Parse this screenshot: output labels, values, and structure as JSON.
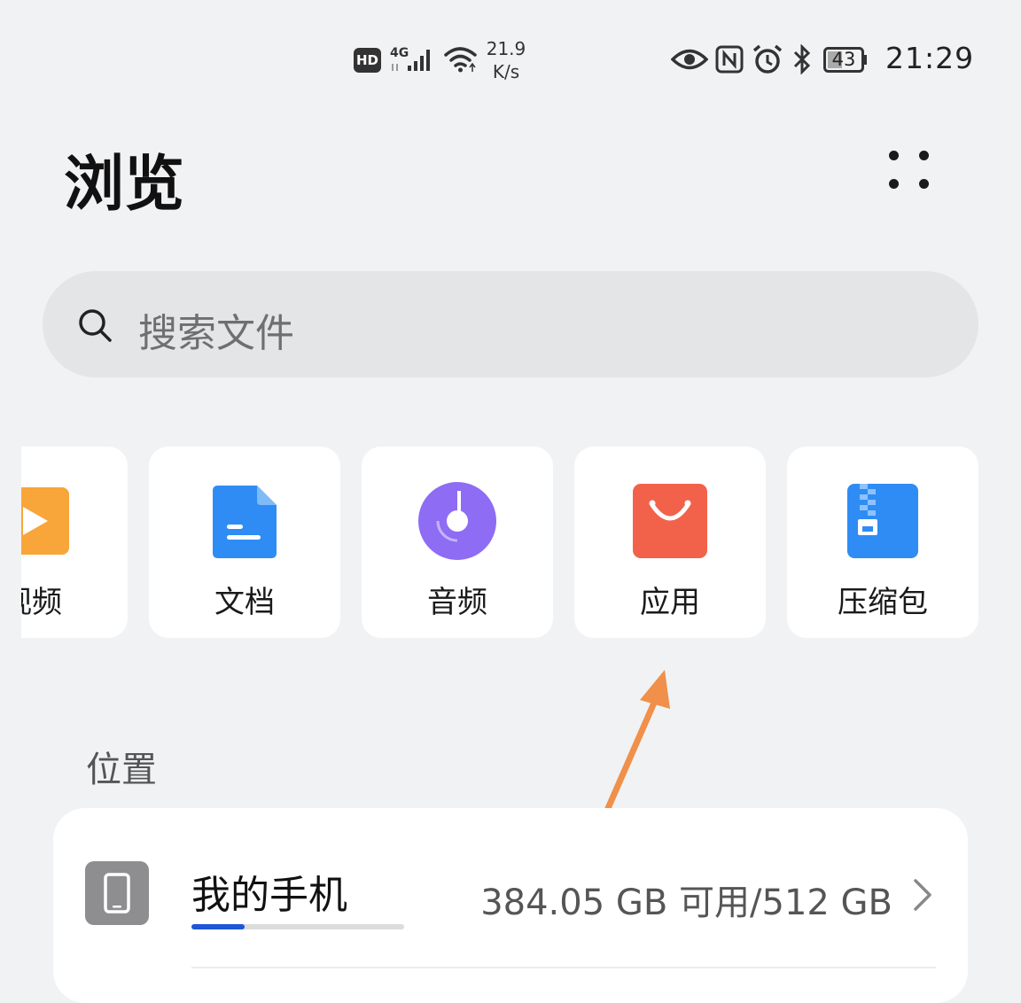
{
  "status_bar": {
    "hd_badge": "HD",
    "network_type": "4G",
    "net_speed_value": "21.9",
    "net_speed_unit": "K/s",
    "battery_level": "43",
    "time": "21:29"
  },
  "header": {
    "title": "浏览"
  },
  "search": {
    "placeholder": "搜索文件"
  },
  "categories": [
    {
      "label": "视频",
      "icon": "video-icon",
      "color": "#f8a53a"
    },
    {
      "label": "文档",
      "icon": "document-icon",
      "color": "#2f8cf4"
    },
    {
      "label": "音频",
      "icon": "music-disc-icon",
      "color": "#8e6cf4"
    },
    {
      "label": "应用",
      "icon": "shopping-bag-icon",
      "color": "#f2624a"
    },
    {
      "label": "压缩包",
      "icon": "zip-archive-icon",
      "color": "#2f8cf4"
    }
  ],
  "locations": {
    "section_title": "位置",
    "items": [
      {
        "name": "我的手机",
        "storage": "384.05 GB 可用/512 GB",
        "used_fraction": 0.25,
        "icon": "phone-icon"
      }
    ]
  },
  "colors": {
    "background": "#f1f2f4",
    "accent": "#1f56d6",
    "annotation_arrow": "#f0904a"
  }
}
